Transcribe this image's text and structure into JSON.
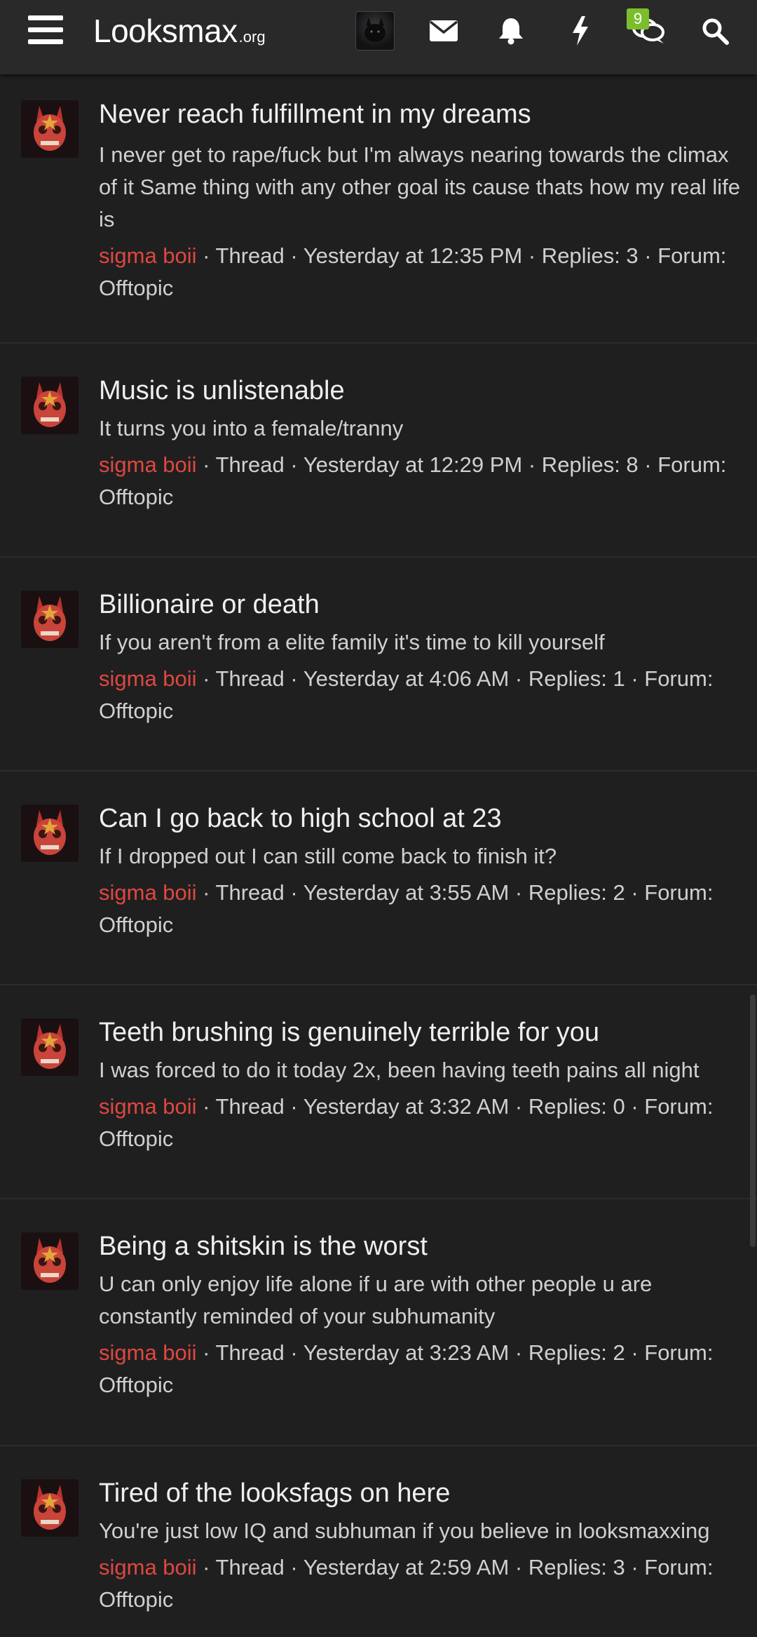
{
  "header": {
    "logo_main": "Looksmax",
    "logo_tld": ".org",
    "notification_badge": "9",
    "icons": [
      "menu-icon",
      "avatar",
      "envelope-icon",
      "bell-icon",
      "lightning-icon",
      "conversations-icon",
      "search-icon"
    ]
  },
  "colors": {
    "background": "#1f1f20",
    "header": "#29292a",
    "username": "#e0473f",
    "badge": "#7bbd2c"
  },
  "threads": [
    {
      "title": "Never reach fulfillment in my dreams",
      "snippet": "I never get to rape/fuck but I'm always nearing towards the climax of it Same thing with any other goal its cause thats how my real life is",
      "user": "sigma boii",
      "meta_rest": " · Thread · Yesterday at 12:35 PM · Replies: 3 · Forum: Offtopic"
    },
    {
      "title": "Music is unlistenable",
      "snippet": "It turns you into a female/tranny",
      "user": "sigma boii",
      "meta_rest": " · Thread · Yesterday at 12:29 PM · Replies: 8 · Forum: Offtopic"
    },
    {
      "title": "Billionaire or death",
      "snippet": "If you aren't from a elite family it's time to kill yourself",
      "user": "sigma boii",
      "meta_rest": " · Thread · Yesterday at 4:06 AM · Replies: 1 · Forum: Offtopic"
    },
    {
      "title": "Can I go back to high school at 23",
      "snippet": "If I dropped out I can still come back to finish it?",
      "user": "sigma boii",
      "meta_rest": " · Thread · Yesterday at 3:55 AM · Replies: 2 · Forum: Offtopic"
    },
    {
      "title": "Teeth brushing is genuinely terrible for you",
      "snippet": "I was forced to do it today 2x, been having teeth pains all night",
      "user": "sigma boii",
      "meta_rest": " · Thread · Yesterday at 3:32 AM · Replies: 0 · Forum: Offtopic"
    },
    {
      "title": "Being a shitskin is the worst",
      "snippet": "U can only enjoy life alone if u are with other people u are constantly reminded of your subhumanity",
      "user": "sigma boii",
      "meta_rest": " · Thread · Yesterday at 3:23 AM · Replies: 2 · Forum: Offtopic"
    },
    {
      "title": "Tired of the looksfags on here",
      "snippet": "You're just low IQ and subhuman if you believe in looksmaxxing",
      "user": "sigma boii",
      "meta_rest": " · Thread · Yesterday at 2:59 AM · Replies: 3 · Forum: Offtopic"
    }
  ]
}
